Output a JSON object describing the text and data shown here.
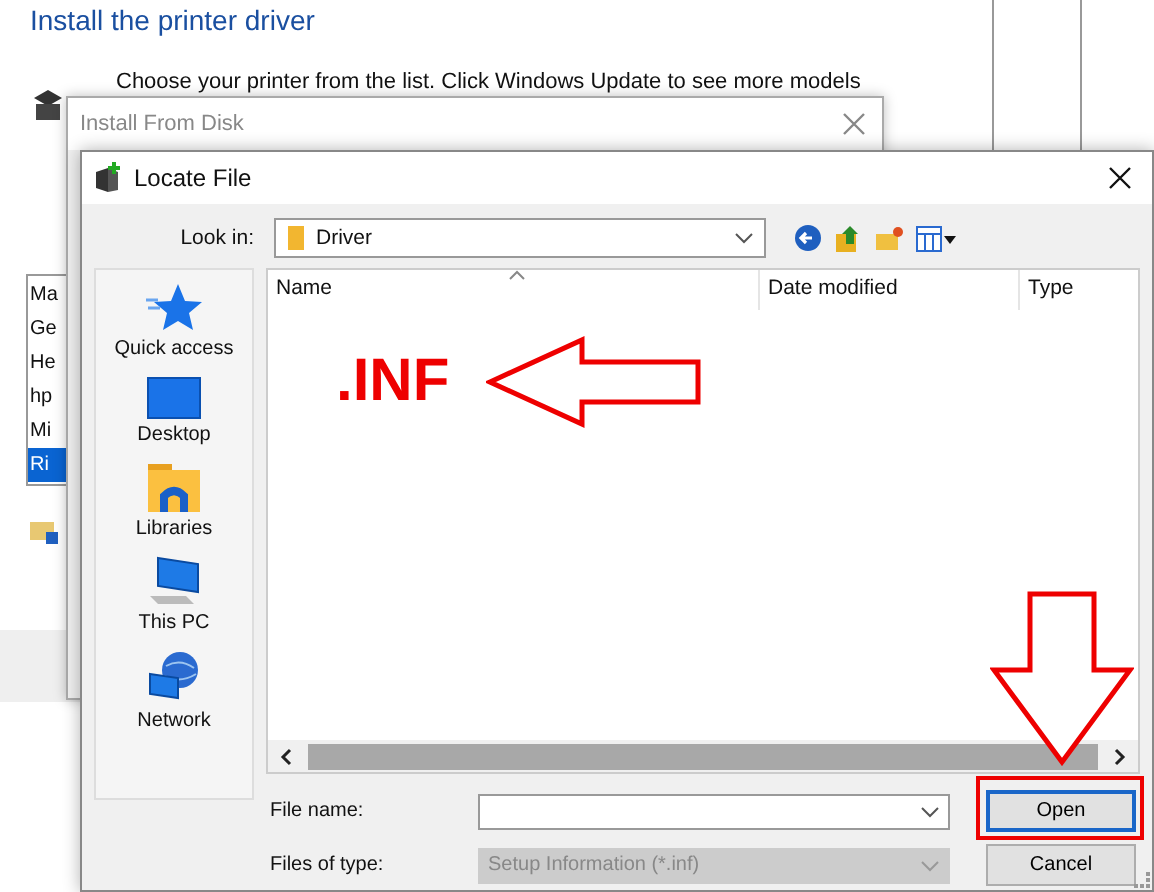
{
  "background_window": {
    "title": "Install the printer driver",
    "instructions": "Choose your printer from the list. Click Windows Update to see more models",
    "manufacturers": [
      {
        "label": "Ma",
        "selected": false
      },
      {
        "label": "Ge",
        "selected": false
      },
      {
        "label": "He",
        "selected": false
      },
      {
        "label": "hp",
        "selected": false
      },
      {
        "label": "Mi",
        "selected": false
      },
      {
        "label": "Ri",
        "selected": true
      }
    ]
  },
  "install_from_disk": {
    "title": "Install From Disk"
  },
  "locate_file": {
    "title": "Locate File",
    "look_in": {
      "label": "Look in:",
      "value": "Driver"
    },
    "places": [
      {
        "label": "Quick access",
        "kind": "star"
      },
      {
        "label": "Desktop",
        "kind": "desktop"
      },
      {
        "label": "Libraries",
        "kind": "libraries"
      },
      {
        "label": "This PC",
        "kind": "pc"
      },
      {
        "label": "Network",
        "kind": "network"
      }
    ],
    "columns": [
      "Name",
      "Date modified",
      "Type"
    ],
    "file_name": {
      "label": "File name:"
    },
    "file_type": {
      "label": "Files of type:",
      "value": "Setup Information (*.inf)",
      "disabled": true
    },
    "buttons": [
      {
        "label": "Open",
        "kind": "default"
      },
      {
        "label": "Cancel",
        "kind": "normal"
      }
    ]
  },
  "annotations": [
    {
      "kind": "text",
      "text": ".INF"
    },
    {
      "kind": "left-arrow"
    },
    {
      "kind": "down-arrow"
    },
    {
      "kind": "highlight-box"
    }
  ]
}
